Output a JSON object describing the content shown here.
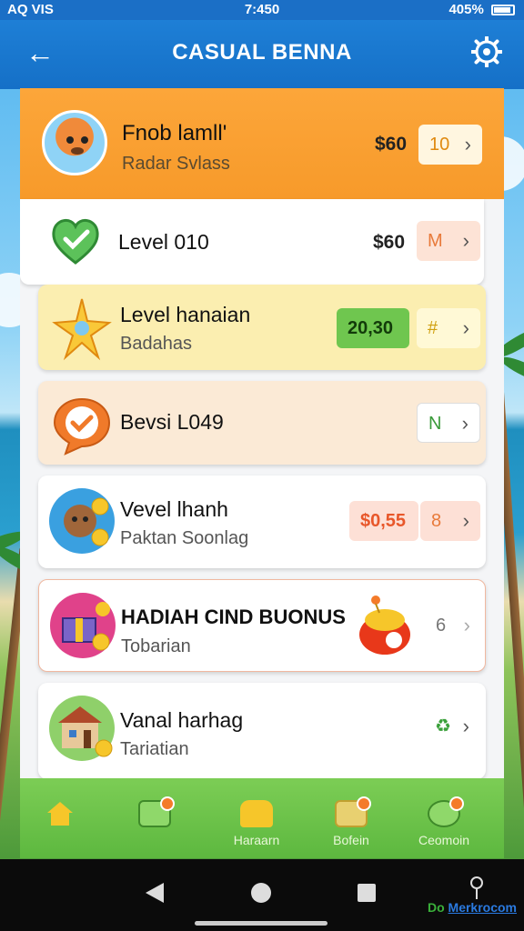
{
  "status_bar": {
    "left": "AQ VIS",
    "time": "7:450",
    "right": "405%"
  },
  "app_bar": {
    "title": "CASUAL BENNA",
    "back_icon": "arrow-left-icon",
    "settings_icon": "gear-icon"
  },
  "cards": [
    {
      "title": "Fnob lamll'",
      "subtitle": "Radar Svlass",
      "price": "$60",
      "button": "10",
      "icon": "fox-avatar-icon"
    },
    {
      "title": "Level 010",
      "subtitle": "",
      "price": "$60",
      "button": "M",
      "icon": "heart-check-icon"
    },
    {
      "title": "Level hanaian",
      "subtitle": "Badahas",
      "price_badge": "20,30",
      "button": "#",
      "icon": "sparkle-icon"
    },
    {
      "title": "Bevsi L049",
      "subtitle": "",
      "button": "N",
      "icon": "chat-check-icon"
    },
    {
      "title": "Vevel lhanh",
      "subtitle": "Paktan Soonlag",
      "price_badge": "$0,55",
      "button": "8",
      "icon": "bear-coins-icon"
    },
    {
      "title": "HADIAH CIND BUONUS",
      "subtitle": "Tobarian",
      "button": "6",
      "icon": "gift-box-icon"
    },
    {
      "title": "Vanal harhag",
      "subtitle": "Tariatian",
      "button": "♻",
      "icon": "house-coins-icon"
    }
  ],
  "bottom_nav": [
    {
      "label": "",
      "icon": "home-icon"
    },
    {
      "label": "",
      "icon": "play-icon"
    },
    {
      "label": "Haraarn",
      "icon": "trophy-icon"
    },
    {
      "label": "Bofein",
      "icon": "calendar-icon"
    },
    {
      "label": "Ceomoin",
      "icon": "target-icon"
    }
  ],
  "watermark": {
    "brand": "Merkrocom",
    "prefix": "Do"
  },
  "colors": {
    "appbar": "#1570c7",
    "orange": "#f79a2a",
    "green": "#5db83f"
  }
}
